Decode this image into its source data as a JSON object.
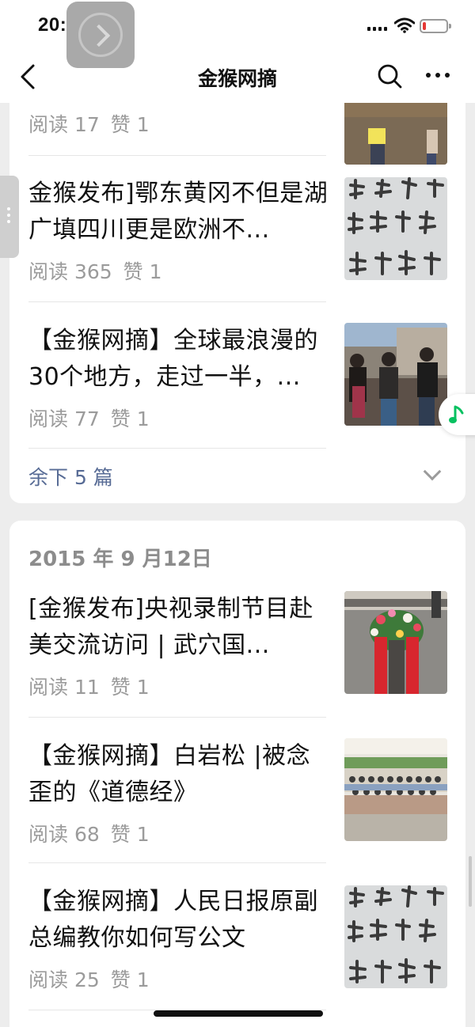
{
  "status_bar": {
    "time": "20:04",
    "battery_level": 0.08
  },
  "nav": {
    "title": "金猴网摘"
  },
  "group1": {
    "articles": [
      {
        "title": "",
        "reads": "阅读 17",
        "likes": "赞 1",
        "thumb": "crowd-photo"
      },
      {
        "title": "金猴发布]鄂东黄冈不但是湖广填四川更是欧洲不...",
        "reads": "阅读 365",
        "likes": "赞 1",
        "thumb": "calligraphy"
      },
      {
        "title": "【金猴网摘】全球最浪漫的30个地方，走过一半，...",
        "reads": "阅读 77",
        "likes": "赞 1",
        "thumb": "crowd-photo"
      }
    ],
    "more_label": "余下 5 篇"
  },
  "group2": {
    "date": "2015 年 9 月12日",
    "articles": [
      {
        "title": "[金猴发布]央视录制节目赴美交流访问 | 武穴国...",
        "reads": "阅读 11",
        "likes": "赞 1",
        "thumb": "wreath-photo"
      },
      {
        "title": "【金猴网摘】白岩松 |被念歪的《道德经》",
        "reads": "阅读 68",
        "likes": "赞 1",
        "thumb": "group-photo"
      },
      {
        "title": "【金猴网摘】人民日报原副总编教你如何写公文",
        "reads": "阅读 25",
        "likes": "赞 1",
        "thumb": "calligraphy"
      }
    ]
  },
  "colors": {
    "link": "#576b95",
    "meta": "#9b9b9b",
    "background": "#ededed",
    "music": "#07c160"
  }
}
